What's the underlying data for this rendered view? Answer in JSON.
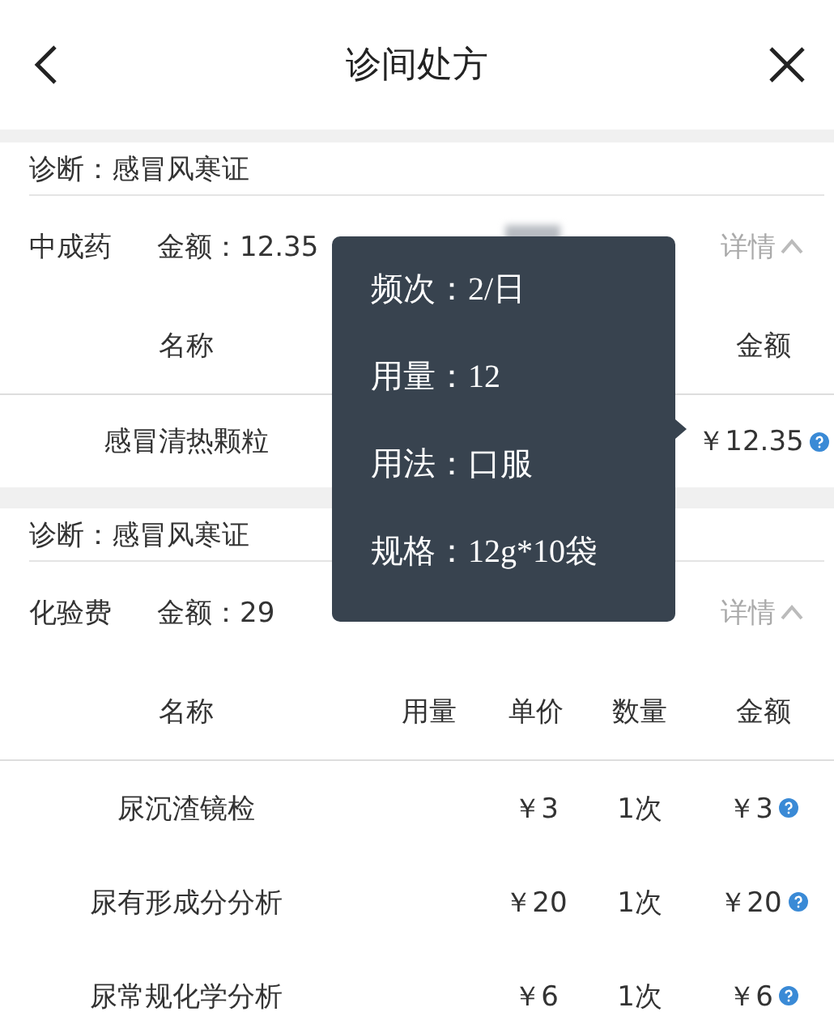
{
  "header": {
    "title": "诊间处方"
  },
  "sections": [
    {
      "diagnosis": "诊断：感冒风寒证",
      "category": "中成药",
      "amount": "金额：12.35",
      "doctor_blurred": true,
      "details": "详情",
      "expanded": true,
      "columns": [
        {
          "kind": "name",
          "label": "名称"
        },
        {
          "kind": "amount",
          "label": "金额"
        }
      ],
      "rows": [
        {
          "name": "感冒清热颗粒",
          "amount": "￥12.35"
        }
      ]
    },
    {
      "diagnosis": "诊断：感冒风寒证",
      "category": "化验费",
      "amount": "金额：29",
      "details": "详情",
      "expanded": true,
      "columns": [
        {
          "kind": "name",
          "label": "名称"
        },
        {
          "kind": "dosage",
          "label": "用量"
        },
        {
          "kind": "price",
          "label": "单价"
        },
        {
          "kind": "quantity",
          "label": "数量"
        },
        {
          "kind": "amount",
          "label": "金额"
        }
      ],
      "rows": [
        {
          "name": "尿沉渣镜检",
          "price": "￥3",
          "quantity": "1次",
          "amount": "￥3"
        },
        {
          "name": "尿有形成分分析",
          "price": "￥20",
          "quantity": "1次",
          "amount": "￥20"
        },
        {
          "name": "尿常规化学分析",
          "price": "￥6",
          "quantity": "1次",
          "amount": "￥6"
        }
      ]
    }
  ],
  "tooltip": {
    "lines": [
      "频次：2/日",
      "用量：12",
      "用法：口服",
      "规格：12g*10袋"
    ]
  }
}
